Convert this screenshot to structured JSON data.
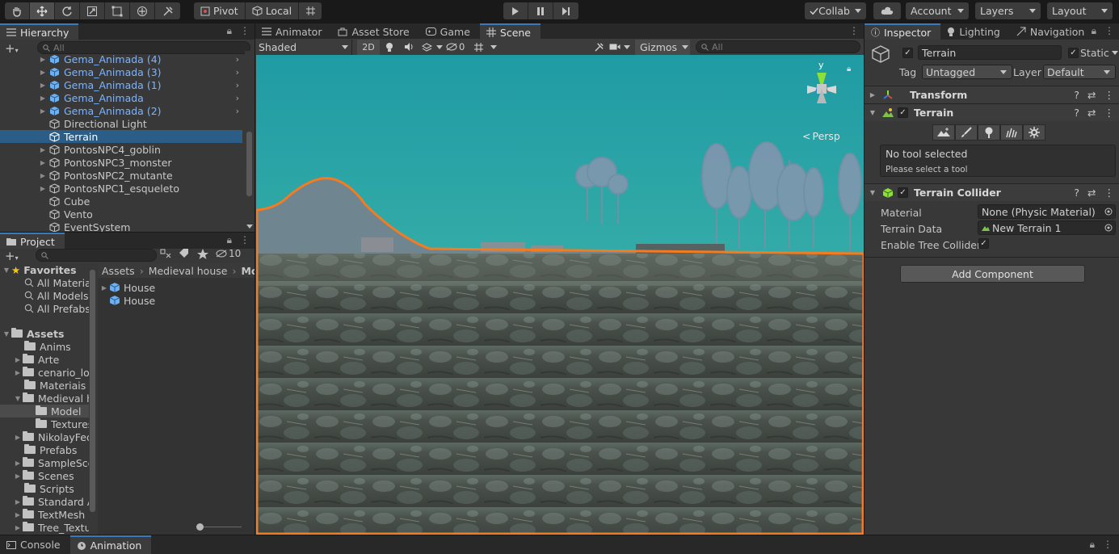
{
  "toolbar": {
    "pivot_label": "Pivot",
    "local_label": "Local",
    "collab_label": "Collab",
    "account_label": "Account",
    "layers_label": "Layers",
    "layout_label": "Layout"
  },
  "hierarchy": {
    "tab_label": "Hierarchy",
    "search_placeholder": "All",
    "items": [
      {
        "label": "Gema_Animada (4)"
      },
      {
        "label": "Gema_Animada (3)"
      },
      {
        "label": "Gema_Animada (1)"
      },
      {
        "label": "Gema_Animada"
      },
      {
        "label": "Gema_Animada (2)"
      },
      {
        "label": "Directional Light"
      },
      {
        "label": "Terrain"
      },
      {
        "label": "PontosNPC4_goblin"
      },
      {
        "label": "PontosNPC3_monster"
      },
      {
        "label": "PontosNPC2_mutante"
      },
      {
        "label": "PontosNPC1_esqueleto"
      },
      {
        "label": "Cube"
      },
      {
        "label": "Vento"
      },
      {
        "label": "EventSystem"
      }
    ]
  },
  "project": {
    "tab_label": "Project",
    "hidden_count": "10",
    "favorites_label": "Favorites",
    "favorites": [
      "All Materia",
      "All Models",
      "All Prefabs"
    ],
    "assets_label": "Assets",
    "folders": [
      "Anims",
      "Arte",
      "cenario_lov",
      "Materiais c",
      "Medieval h",
      "Model",
      "Textures",
      "NikolayFed",
      "Prefabs",
      "SampleSce",
      "Scenes",
      "Scripts",
      "Standard A",
      "TextMesh",
      "Tree_Textu"
    ],
    "breadcrumb": [
      "Assets",
      "Medieval house",
      "Mod"
    ],
    "files": [
      "House",
      "House"
    ]
  },
  "scene": {
    "tabs": [
      "Animator",
      "Asset Store",
      "Game",
      "Scene"
    ],
    "shading_mode": "Shaded",
    "mode_2d": "2D",
    "hidden_count": "0",
    "gizmos_label": "Gizmos",
    "search_placeholder": "All",
    "persp_label": "Persp",
    "gizmo_axis": "y"
  },
  "inspector": {
    "tabs": [
      "Inspector",
      "Lighting",
      "Navigation"
    ],
    "object_name": "Terrain",
    "static_label": "Static",
    "tag_label": "Tag",
    "tag_value": "Untagged",
    "layer_label": "Layer",
    "layer_value": "Default",
    "transform_label": "Transform",
    "terrain_label": "Terrain",
    "no_tool_title": "No tool selected",
    "no_tool_sub": "Please select a tool",
    "collider_label": "Terrain Collider",
    "material_label": "Material",
    "material_value": "None (Physic Material)",
    "terrain_data_label": "Terrain Data",
    "terrain_data_value": "New Terrain 1",
    "enable_tree_label": "Enable Tree Colliders",
    "add_component_label": "Add Component"
  },
  "bottom": {
    "tabs": [
      "Console",
      "Animation"
    ]
  },
  "colors": {
    "selection": "#2c5d87",
    "prefab_text": "#7cb4ff",
    "outline": "#f47b20",
    "sky_top": "#2a9fa8"
  }
}
